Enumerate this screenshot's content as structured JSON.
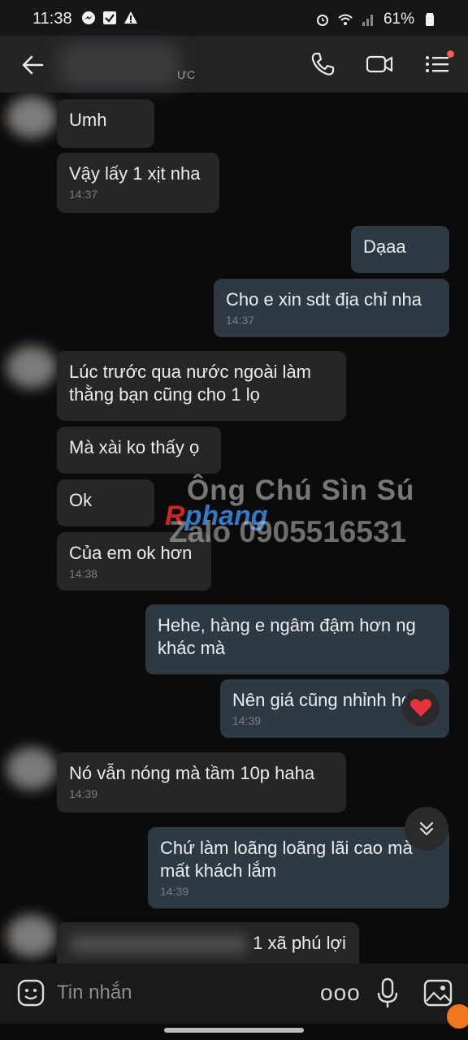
{
  "status": {
    "time": "11:38",
    "battery": "61%",
    "left_icons": [
      "messenger-icon",
      "check-box-icon",
      "warning-icon"
    ],
    "right_icons": [
      "alarm-icon",
      "wifi-icon",
      "signal-icon",
      "battery-icon"
    ]
  },
  "header": {
    "contact_suffix": "ƯC",
    "icons": [
      "back-arrow-icon",
      "phone-icon",
      "video-icon",
      "menu-icon"
    ]
  },
  "messages": [
    {
      "side": "in",
      "text": "Umh"
    },
    {
      "side": "in",
      "text": "Vậy lấy 1 xịt nha",
      "time": "14:37"
    },
    {
      "side": "out",
      "text": "Dạaa"
    },
    {
      "side": "out",
      "text": "Cho e xin sdt địa chỉ nha",
      "time": "14:37"
    },
    {
      "side": "in",
      "text": "Lúc trước qua nước ngoài làm thằng bạn cũng cho 1 lọ"
    },
    {
      "side": "in",
      "text": "Mà xài ko thấy ọ"
    },
    {
      "side": "in",
      "text": "Ok"
    },
    {
      "side": "in",
      "text": "Của em ok hơn",
      "time": "14:38"
    },
    {
      "side": "out",
      "text": "Hehe, hàng e ngâm đậm hơn ng khác mà"
    },
    {
      "side": "out",
      "text": "Nên giá cũng nhỉnh hơn",
      "time": "14:39"
    },
    {
      "side": "in",
      "text": "Nó vẫn nóng mà tầm 10p haha",
      "time": "14:39"
    },
    {
      "side": "out",
      "text": "Chứ làm loãng loãng lãi cao mà mất khách lắm",
      "time": "14:39"
    },
    {
      "side": "in",
      "text": "1 xã phú lợi"
    }
  ],
  "watermark": {
    "line1": "Ông Chú Sìn Sú",
    "line2": "Zalo 0905516531",
    "logo_r": "R",
    "logo_rest": "phang"
  },
  "input": {
    "placeholder": "Tin nhắn",
    "more": "ooo"
  },
  "colors": {
    "background": "#0b0b0c",
    "incoming_bubble": "#262627",
    "outgoing_bubble": "#2d3a44",
    "timestamp": "#7b7c7f",
    "reaction_heart": "#e8323c"
  }
}
